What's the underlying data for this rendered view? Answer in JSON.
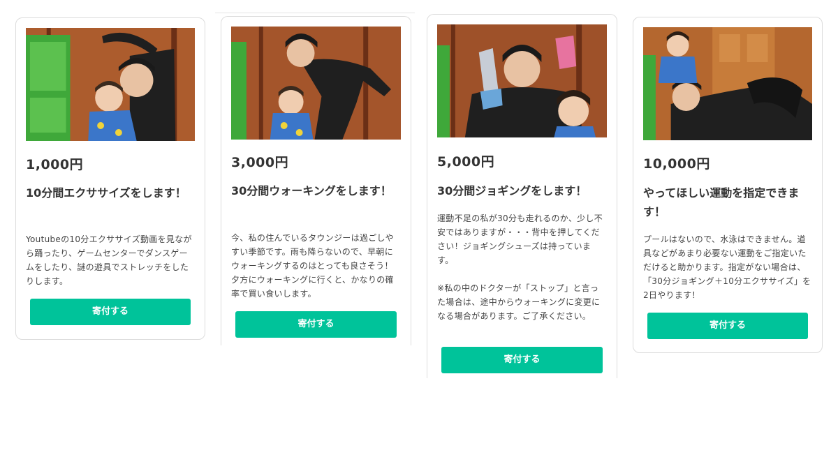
{
  "cards": [
    {
      "price": "1,000円",
      "title": "10分間エクササイズをします！",
      "description": "Youtubeの10分エクササイズ動画を見ながら踊ったり、ゲームセンターでダンスゲームをしたり、謎の遊具でストレッチをしたりします。",
      "button_label": "寄付する"
    },
    {
      "price": "3,000円",
      "title": "30分間ウォーキングをします！",
      "description": "今、私の住んでいるタウンジーは過ごしやすい季節です。雨も降らないので、早朝にウォーキングするのはとっても良さそう！夕方にウォーキングに行くと、かなりの確率で買い食いします。",
      "button_label": "寄付する"
    },
    {
      "price": "5,000円",
      "title": "30分間ジョギングをします！",
      "description": "運動不足の私が30分も走れるのか、少し不安ではありますが・・・背中を押してください！ジョギングシューズは持っています。\n\n※私の中のドクターが「ストップ」と言った場合は、途中からウォーキングに変更になる場合があります。ご了承ください。",
      "button_label": "寄付する"
    },
    {
      "price": "10,000円",
      "title": "やってほしい運動を指定できます！",
      "description": "プールはないので、水泳はできません。道具などがあまり必要ない運動をご指定いただけると助かります。指定がない場合は、「30分ジョギング＋10分エクササイズ」を2日やります！",
      "button_label": "寄付する"
    }
  ],
  "colors": {
    "accent": "#00c39a",
    "card_border": "#dcdcdc",
    "text": "#333333"
  }
}
